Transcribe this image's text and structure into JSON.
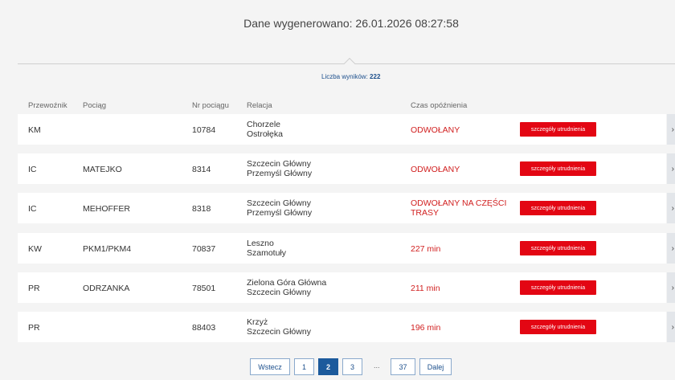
{
  "header": {
    "generated": "Dane wygenerowano: 26.01.2026 08:27:58",
    "results_label": "Liczba wyników:",
    "results_count": "222"
  },
  "columns": [
    "Przewoźnik",
    "Pociąg",
    "Nr pociągu",
    "Relacja",
    "Czas opóźnienia"
  ],
  "rows": [
    {
      "carrier": "KM",
      "train": "",
      "number": "10784",
      "from": "Chorzele",
      "to": "Ostrołęka",
      "delay1": "ODWOŁANY",
      "delay2": "",
      "button": "szczegóły utrudnienia"
    },
    {
      "carrier": "IC",
      "train": "MATEJKO",
      "number": "8314",
      "from": "Szczecin Główny",
      "to": "Przemyśl Główny",
      "delay1": "ODWOŁANY",
      "delay2": "",
      "button": "szczegóły utrudnienia"
    },
    {
      "carrier": "IC",
      "train": "MEHOFFER",
      "number": "8318",
      "from": "Szczecin Główny",
      "to": "Przemyśl Główny",
      "delay1": "ODWOŁANY NA CZĘŚCI",
      "delay2": "TRASY",
      "button": "szczegóły utrudnienia"
    },
    {
      "carrier": "KW",
      "train": "PKM1/PKM4",
      "number": "70837",
      "from": "Leszno",
      "to": "Szamotuły",
      "delay1": "227 min",
      "delay2": "",
      "button": "szczegóły utrudnienia"
    },
    {
      "carrier": "PR",
      "train": "ODRZANKA",
      "number": "78501",
      "from": "Zielona Góra Główna",
      "to": "Szczecin Główny",
      "delay1": "211 min",
      "delay2": "",
      "button": "szczegóły utrudnienia"
    },
    {
      "carrier": "PR",
      "train": "",
      "number": "88403",
      "from": "Krzyż",
      "to": "Szczecin Główny",
      "delay1": "196 min",
      "delay2": "",
      "button": "szczegóły utrudnienia"
    }
  ],
  "expand_glyph": "›",
  "pagination": {
    "prev": "Wstecz",
    "pages": [
      "1",
      "2",
      "3"
    ],
    "active": "2",
    "ellipsis": "...",
    "last": "37",
    "next": "Dalej"
  },
  "colors": {
    "accent_red": "#e30613",
    "delay_red": "#d11f1f",
    "link_blue": "#1c4f8c"
  }
}
